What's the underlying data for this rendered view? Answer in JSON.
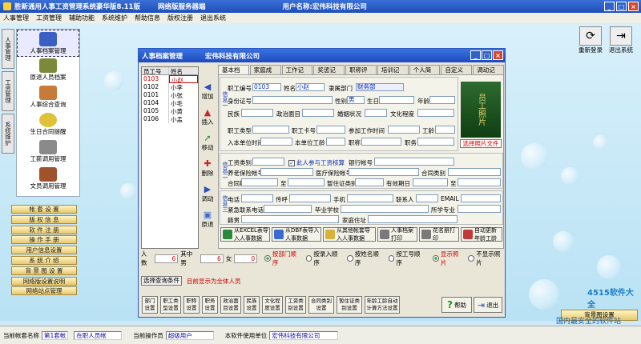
{
  "app": {
    "title": "胜新通用人事工资管理系统豪华版8.11版",
    "subtitle": "网络版服务器端",
    "user_label": "用户名称:宏伟科技有限公司"
  },
  "menu": [
    "人事管理",
    "工资管理",
    "辅助功能",
    "系统维护",
    "帮助信息",
    "版权注册",
    "退出系统"
  ],
  "left_tabs": [
    "人事管理",
    "工资管理",
    "系统维护"
  ],
  "nav_items": [
    "人事档案管理",
    "原退人员档案",
    "人事综合查询",
    "生日合同提醒",
    "工薪调用管理",
    "文员调用管理"
  ],
  "side_buttons": [
    "帐 套 设 置",
    "版 权 信 息",
    "软 件 注 册",
    "操 作 手 册",
    "用户信息设置",
    "系 统 介 绍",
    "背 景 图 设 置",
    "网络版设置说明",
    "网络站点管理"
  ],
  "top_right": {
    "relogin": "重新登录",
    "exit": "退出系统"
  },
  "bottom_right": {
    "bg_button": "背景图设置",
    "brand1": "4515软件大全",
    "brand2": "国内最安全的软件站"
  },
  "status": {
    "account_label": "当前帐套名称",
    "account_value": "第1套帐",
    "account_extra": "在职人员帐",
    "operator_label": "当前操作员",
    "operator_value": "超级用户",
    "unit_label": "本软件使用单位",
    "unit_value": "宏伟科技有限公司"
  },
  "dialog": {
    "title": "人事档案管理",
    "company": "宏伟科技有限公司",
    "grid_headers": [
      "员工号",
      "姓名"
    ],
    "grid_rows": [
      {
        "id": "0103",
        "name": "小赵"
      },
      {
        "id": "0102",
        "name": "小李"
      },
      {
        "id": "0101",
        "name": "小张"
      },
      {
        "id": "0104",
        "name": "小毛"
      },
      {
        "id": "0105",
        "name": "小黄"
      },
      {
        "id": "0106",
        "name": "小孟"
      }
    ],
    "vbuttons": [
      "增加",
      "插入",
      "移动",
      "删除",
      "调动",
      "原退"
    ],
    "tabs": [
      "基本档案",
      "家庭成员",
      "工作记录",
      "奖惩记录",
      "职称评定",
      "培训记录",
      "个人简历",
      "自定义项",
      "调动记录"
    ],
    "sections": {
      "s1": "信息一",
      "s2": "信息二",
      "s3": "信息三"
    },
    "fields": {
      "emp_no_label": "职工编号",
      "emp_no": "0103",
      "name_label": "姓名",
      "name": "小赵",
      "dept_label": "隶属部门",
      "dept": "财务部",
      "id_label": "身份证号",
      "gender_label": "性别",
      "gender": "男",
      "birth_label": "生日",
      "age_label": "年龄",
      "ethnic_label": "民族",
      "party_label": "政治面目",
      "marital_label": "婚姻状况",
      "edu_label": "文化程度",
      "type_label": "职工类型",
      "card_label": "职工卡号",
      "join_label": "参加工作时间",
      "seniority_label": "工龄",
      "entry_label": "入本单位时间",
      "entry_seniority_label": "本单位工龄",
      "title_label": "职称",
      "post_label": "职务",
      "salary_type_label": "工资类别",
      "join_check": "此人参与工资核算",
      "bank_label": "银行帐号",
      "pension_label": "养老保险帐号",
      "medical_label": "医疗保险帐号",
      "contract_type_label": "合同类别",
      "contract_period_label": "合同期",
      "to_label": "至",
      "temp_cert_label": "暂住证类别",
      "valid_label": "有效期日",
      "to2_label": "至",
      "phone_label": "电话",
      "pager_label": "传呼",
      "mobile_label": "手机",
      "contact_label": "联系人",
      "email_label": "EMAIL",
      "emergency_label": "紧急联系电话",
      "school_label": "毕业学校",
      "major_label": "所学专业",
      "native_label": "籍贯",
      "address_label": "家庭住址"
    },
    "photo_text": "员工照片",
    "photo_button": "选择照片文件",
    "action_buttons": [
      "从EXCEL表导入人事数据",
      "从DBF表导入人事数据",
      "从其他帐套导入人事数据",
      "人事档案打印",
      "花名册打印",
      "自动更新年龄工龄"
    ],
    "counts": {
      "total_label": "人数",
      "total": "6",
      "male_label": "其中男",
      "male": "6",
      "female_label": "女",
      "female": "0"
    },
    "sort_options": [
      "按部门顺序",
      "按录入顺序",
      "按姓名顺序",
      "按工号顺序"
    ],
    "photo_options": [
      "显示照片",
      "不显示照片"
    ],
    "query_button": "选择查询条件",
    "query_text": "目前显示为全体人员",
    "bottom_buttons": [
      "部门设置",
      "职工类型设置",
      "职称设置",
      "职务设置",
      "政治面目设置",
      "民族设置",
      "文化程度设置",
      "工资类别设置",
      "合同类别设置",
      "暂住证类别设置",
      "年龄工龄自动计算方法设置"
    ],
    "help": "帮助",
    "exit": "退出"
  }
}
